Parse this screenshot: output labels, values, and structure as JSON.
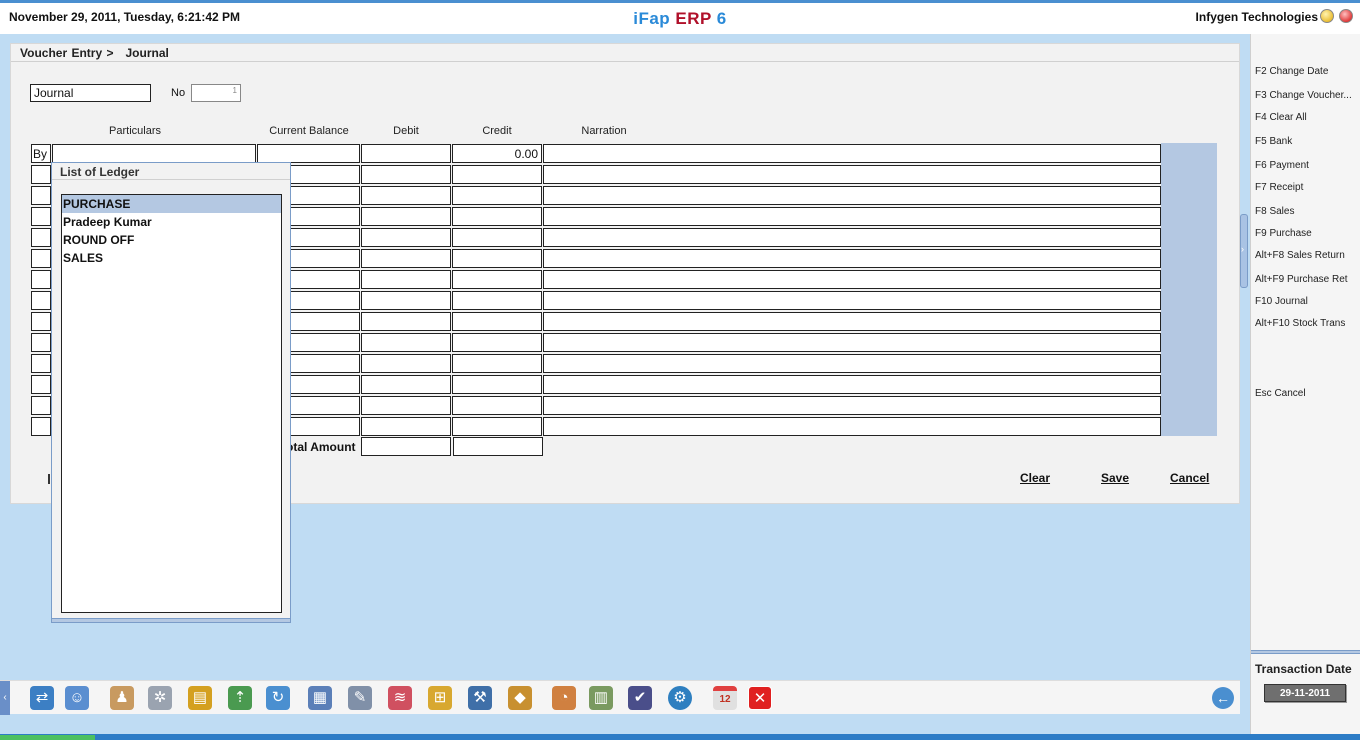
{
  "header": {
    "datetime": "November  29, 2011, Tuesday, 6:21:42 PM",
    "app_name_part1": "iFap",
    "app_name_part2": "ERP",
    "app_name_part3": "6",
    "company": "Infygen Technologies"
  },
  "breadcrumb": {
    "section": "Voucher Entry >",
    "page": "Journal"
  },
  "form": {
    "voucher_type": "Journal",
    "no_label": "No",
    "no_value": "1"
  },
  "columns": {
    "particulars": "Particulars",
    "current_balance": "Current Balance",
    "debit": "Debit",
    "credit": "Credit",
    "narration": "Narration"
  },
  "grid": {
    "first_row_prefix": "By",
    "first_row_credit": "0.00"
  },
  "total_label": "otal Amount",
  "actions": {
    "clear": "Clear",
    "save": "Save",
    "cancel": "Cancel"
  },
  "ledger_popup": {
    "title": "List of Ledger",
    "items": [
      "PURCHASE",
      "Pradeep Kumar",
      "ROUND OFF",
      "SALES"
    ],
    "selected": "PURCHASE"
  },
  "shortcuts": [
    "F2 Change Date",
    "F3 Change Voucher...",
    "F4 Clear All",
    "F5 Bank",
    "F6 Payment",
    "F7 Receipt",
    "F8 Sales",
    "F9 Purchase",
    "Alt+F8 Sales Return",
    "Alt+F9 Purchase Ret",
    "F10 Journal",
    "Alt+F10 Stock Trans",
    "Esc Cancel"
  ],
  "transaction": {
    "label": "Transaction Date",
    "value": "29-11-2011"
  },
  "toolbar_icons": [
    "transactions-icon",
    "user-icon",
    "contacts-icon",
    "settings-icon",
    "ledger-book-icon",
    "cart-icon",
    "sync-icon",
    "window-icon",
    "report-icon",
    "chart-icon",
    "tree-icon",
    "tools-icon",
    "package-icon",
    "gauge-icon",
    "spreadsheet-icon",
    "save-disk-icon",
    "gear-icon",
    "calendar-icon",
    "close-icon"
  ],
  "calendar_day": "12"
}
